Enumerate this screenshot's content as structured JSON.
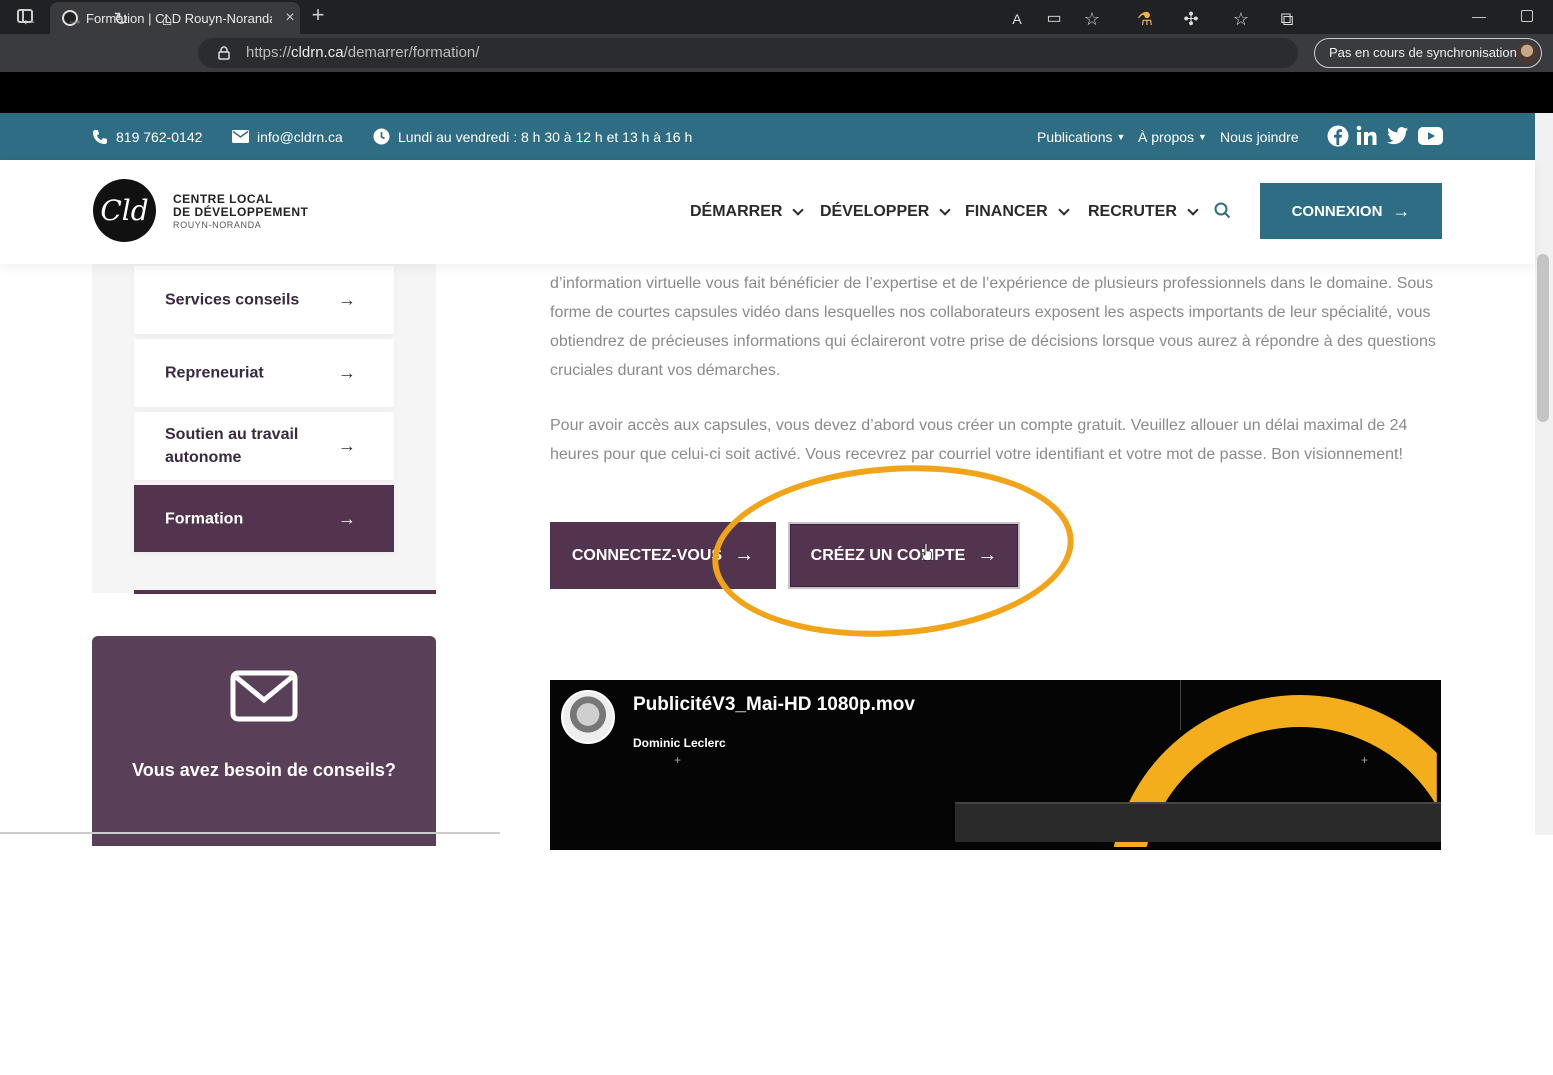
{
  "browser": {
    "tab_title": "Formation | CLD Rouyn-Noranda",
    "url_prefix": "https://",
    "url_host": "cldrn.ca",
    "url_path": "/demarrer/formation/",
    "sync_label": "Pas en cours de synchronisation"
  },
  "topbar": {
    "phone": "819 762-0142",
    "email": "info@cldrn.ca",
    "hours": "Lundi au vendredi : 8 h 30 à 12 h et 13 h à 16 h",
    "links": [
      "Publications",
      "À propos",
      "Nous joindre"
    ]
  },
  "header": {
    "logo_mark": "Cld",
    "logo_line1": "CENTRE LOCAL",
    "logo_line2": "DE DÉVELOPPEMENT",
    "logo_line3": "ROUYN-NORANDA",
    "nav": [
      "DÉMARRER",
      "DÉVELOPPER",
      "FINANCER",
      "RECRUTER"
    ],
    "connexion": "CONNEXION"
  },
  "sidebar": {
    "items": [
      {
        "label": "Services conseils"
      },
      {
        "label": "Repreneuriat"
      },
      {
        "label": "Soutien au travail autonome"
      },
      {
        "label": "Formation"
      }
    ],
    "advice_title": "Vous avez besoin de conseils?"
  },
  "main": {
    "para1": "d’information virtuelle vous fait bénéficier de l’expertise et de l’expérience de plusieurs professionnels dans le domaine. Sous forme de courtes capsules vidéo dans lesquelles nos collaborateurs exposent les aspects importants de leur spécialité, vous obtiendrez de précieuses informations qui éclaireront votre prise de décisions lorsque vous aurez à répondre à des questions cruciales durant vos démarches.",
    "para2": "Pour avoir accès aux capsules, vous devez d’abord vous créer un compte gratuit. Veuillez allouer un délai maximal de 24 heures pour que celui-ci soit activé. Vous recevrez par courriel votre identifiant et votre mot de passe. Bon visionnement!",
    "btn_connect": "CONNECTEZ-VOUS",
    "btn_create": "CRÉEZ UN COMPTE"
  },
  "video": {
    "title": "PublicitéV3_Mai-HD 1080p.mov",
    "author": "Dominic Leclerc"
  },
  "colors": {
    "primary_plum": "#52344f",
    "teal": "#2e6d83",
    "highlight": "#f2a419"
  }
}
